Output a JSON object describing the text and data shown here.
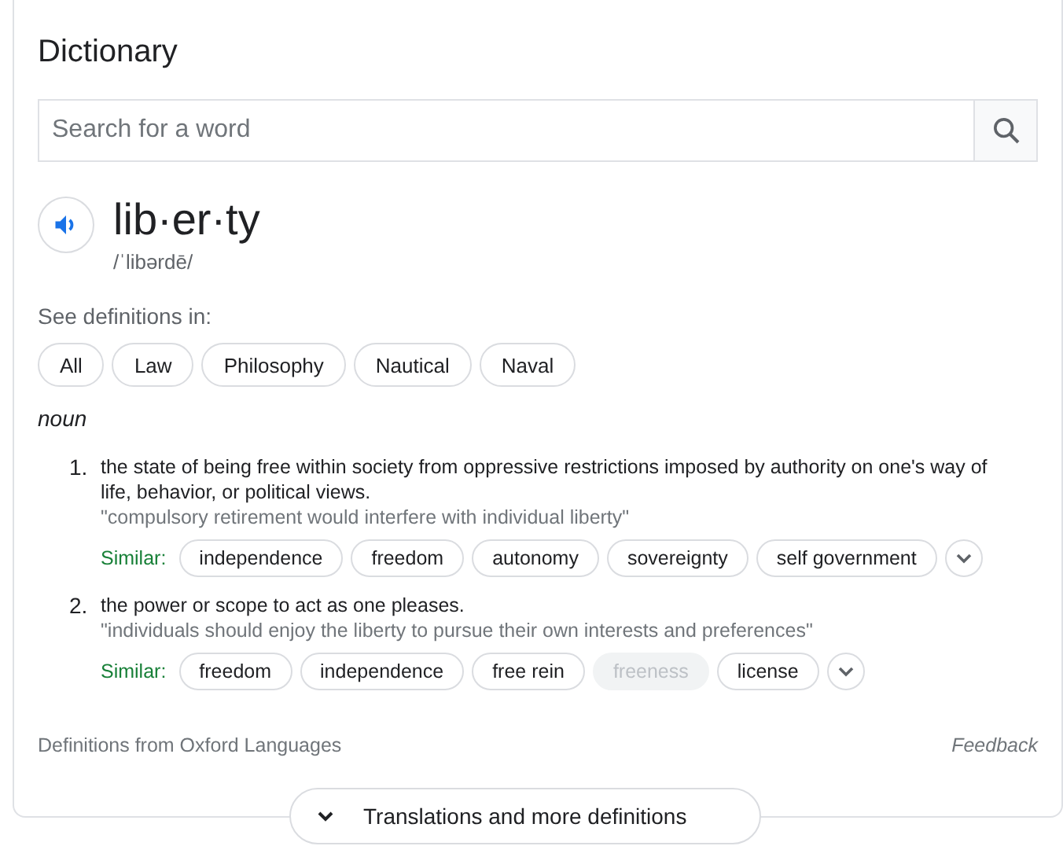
{
  "title": "Dictionary",
  "search": {
    "placeholder": "Search for a word"
  },
  "entry": {
    "word": "lib·er·ty",
    "pronunciation": "/ˈlibərdē/"
  },
  "see_definitions_label": "See definitions in:",
  "domains": [
    {
      "label": "All"
    },
    {
      "label": "Law"
    },
    {
      "label": "Philosophy"
    },
    {
      "label": "Nautical"
    },
    {
      "label": "Naval"
    }
  ],
  "part_of_speech": "noun",
  "definitions": [
    {
      "number": "1.",
      "text": "the state of being free within society from oppressive restrictions imposed by authority on one's way of life, behavior, or political views.",
      "example": "\"compulsory retirement would interfere with individual liberty\"",
      "similar_label": "Similar:",
      "similar": [
        {
          "label": "independence",
          "disabled": false
        },
        {
          "label": "freedom",
          "disabled": false
        },
        {
          "label": "autonomy",
          "disabled": false
        },
        {
          "label": "sovereignty",
          "disabled": false
        },
        {
          "label": "self government",
          "disabled": false
        }
      ]
    },
    {
      "number": "2.",
      "text": "the power or scope to act as one pleases.",
      "example": "\"individuals should enjoy the liberty to pursue their own interests and preferences\"",
      "similar_label": "Similar:",
      "similar": [
        {
          "label": "freedom",
          "disabled": false
        },
        {
          "label": "independence",
          "disabled": false
        },
        {
          "label": "free rein",
          "disabled": false
        },
        {
          "label": "freeness",
          "disabled": true
        },
        {
          "label": "license",
          "disabled": false
        }
      ]
    }
  ],
  "source": "Definitions from Oxford Languages",
  "feedback": "Feedback",
  "more_button": "Translations and more definitions"
}
